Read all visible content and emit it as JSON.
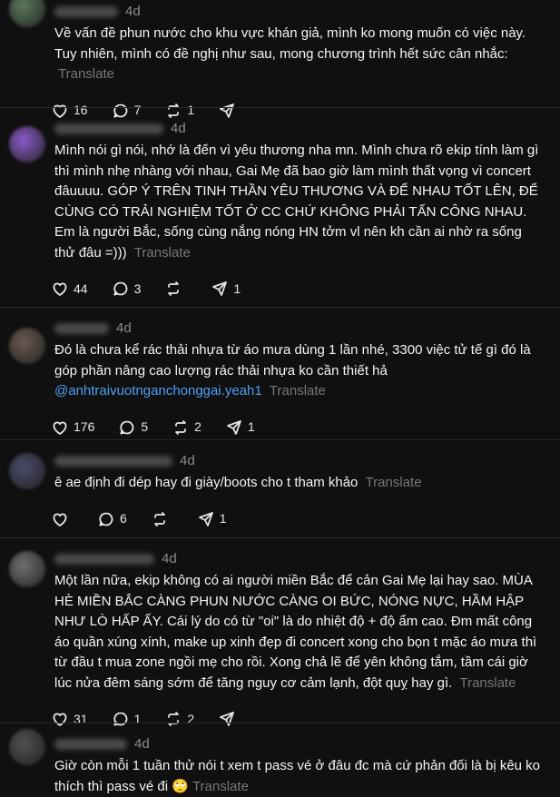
{
  "posts": [
    {
      "time": "4d",
      "avatar_color": "#5a7a5a",
      "segments": [
        {
          "t": "text",
          "v": "Về vấn đề phun nước cho khu vực khán giả, mình ko mong muốn có việc này. Tuy nhiên, mình có đề nghị như sau, mong chương trình hết sức cân nhắc: "
        }
      ],
      "translate": "Translate",
      "likes": "16",
      "replies": "7",
      "reposts": "1",
      "shares": ""
    },
    {
      "time": "4d",
      "avatar_color": "#8a5ac8",
      "segments": [
        {
          "t": "text",
          "v": "Mình nói gì nói, nhớ là đến vì yêu thương nha mn. Mình chưa rõ ekip tính làm gì thì mình nhẹ nhàng với nhau, Gai Mẹ đã bao giờ làm mình thất vọng vì concert đâuuuu. GÓP Ý TRÊN TINH THẦN YÊU THƯƠNG VÀ ĐỂ NHAU TỐT LÊN, ĐỂ CÙNG CÓ TRẢI NGHIỆM TỐT Ở CC CHỨ KHÔNG PHẢI TẤN CÔNG NHAU. Em là người Bắc, sống cùng nắng nóng HN tởm vl nên kh cần ai nhờ ra sống thử đâu =))) "
        }
      ],
      "translate": "Translate",
      "likes": "44",
      "replies": "3",
      "reposts": "",
      "shares": "1"
    },
    {
      "time": "4d",
      "avatar_color": "#6a5a50",
      "segments": [
        {
          "t": "text",
          "v": "Đó là chưa kể rác thải nhựa từ áo mưa dùng 1 lần nhé, 3300 việc tử tế gì đó là góp phần nâng cao lượng rác thải nhựa ko cần thiết hả "
        },
        {
          "t": "mention",
          "v": "@anhtraivuotnganchonggai.yeah1"
        },
        {
          "t": "text",
          "v": " "
        }
      ],
      "translate": "Translate",
      "likes": "176",
      "replies": "5",
      "reposts": "2",
      "shares": "1"
    },
    {
      "time": "4d",
      "avatar_color": "#4a4a6a",
      "segments": [
        {
          "t": "text",
          "v": "ê ae định đi dép hay đi giày/boots cho t tham khảo "
        }
      ],
      "translate": "Translate",
      "likes": "",
      "replies": "6",
      "reposts": "",
      "shares": "1"
    },
    {
      "time": "4d",
      "avatar_color": "#707070",
      "segments": [
        {
          "t": "text",
          "v": "Một lần nữa, ekip không có ai người miền Bắc để cản Gai Mẹ lại hay sao. MÙA HÈ MIỀN BẮC CÀNG PHUN NƯỚC CÀNG OI BỨC, NÓNG NỰC, HẦM HẬP NHƯ LÒ HẤP ẤY. Cái lý do có từ \"oi\" là do nhiệt độ + độ ẩm cao. Đm mất công áo quần xúng xính, make up xinh đẹp đi concert xong cho bọn t mặc áo mưa thì từ đầu t mua zone ngồi mẹ cho rồi. Xong chả lẽ để yên không tắm, tầm cái giờ lúc nửa đêm sáng sớm để tăng nguy cơ cảm lạnh, đột quỵ hay gì. "
        }
      ],
      "translate": "Translate",
      "likes": "31",
      "replies": "1",
      "reposts": "2",
      "shares": ""
    },
    {
      "time": "4d",
      "avatar_color": "#505050",
      "segments": [
        {
          "t": "text",
          "v": "Giờ còn mỗi 1 tuần thử nói t xem t pass vé ở đâu đc mà cứ phản đối là bị kêu ko thích thì pass vé đi "
        },
        {
          "t": "emoji",
          "v": "🙄"
        }
      ],
      "translate": "Translate",
      "likes": "",
      "replies": "",
      "reposts": "",
      "shares": ""
    }
  ]
}
